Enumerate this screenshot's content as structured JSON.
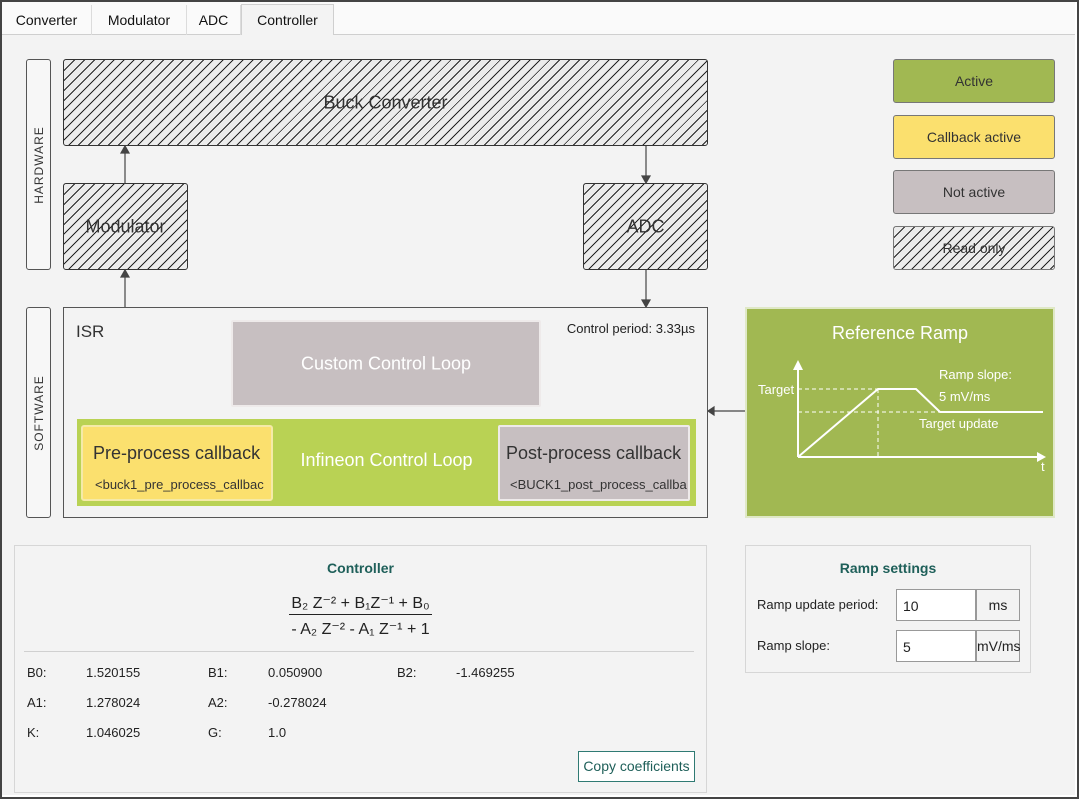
{
  "tabs": [
    {
      "label": "Converter"
    },
    {
      "label": "Modulator"
    },
    {
      "label": "ADC"
    },
    {
      "label": "Controller"
    }
  ],
  "diagram": {
    "hardware_label": "HARDWARE",
    "software_label": "SOFTWARE",
    "buck_converter": "Buck Converter",
    "modulator": "Modulator",
    "adc": "ADC",
    "isr": "ISR",
    "control_period": "Control period: 3.33µs",
    "custom_loop": "Custom Control Loop",
    "infineon_loop": "Infineon Control Loop",
    "pre_process": "Pre-process callback",
    "pre_process_fn": "<buck1_pre_process_callbac",
    "post_process": "Post-process callback",
    "post_process_fn": "<BUCK1_post_process_callba"
  },
  "legend": {
    "active": "Active",
    "callback_active": "Callback active",
    "not_active": "Not active",
    "read_only": "Read only"
  },
  "ramp_diagram": {
    "title": "Reference Ramp",
    "target": "Target",
    "ramp_slope_line1": "Ramp slope:",
    "ramp_slope_line2": "5 mV/ms",
    "target_update": "Target update",
    "t_axis": "t"
  },
  "controller": {
    "title": "Controller",
    "numerator": "B₂ Z⁻² + B₁Z⁻¹ + B₀",
    "denominator": "- A₂ Z⁻² - A₁ Z⁻¹ + 1",
    "coefficients": [
      {
        "label": "B0:",
        "value": "1.520155"
      },
      {
        "label": "B1:",
        "value": "0.050900"
      },
      {
        "label": "B2:",
        "value": "-1.469255"
      },
      {
        "label": "A1:",
        "value": "1.278024"
      },
      {
        "label": "A2:",
        "value": "-0.278024"
      },
      {
        "label": "K:",
        "value": "1.046025"
      },
      {
        "label": "G:",
        "value": "1.0"
      }
    ],
    "copy_button": "Copy coefficients"
  },
  "ramp_settings": {
    "title": "Ramp settings",
    "update_period_label": "Ramp update period:",
    "update_period_value": "10",
    "update_period_unit": "ms",
    "slope_label": "Ramp slope:",
    "slope_value": "5",
    "slope_unit": "mV/ms"
  },
  "colors": {
    "active": "#a1b852",
    "callback_active": "#fbe06e",
    "not_active": "#c7bfc1",
    "infineon_band": "#b9d254",
    "accent_text": "#1e5f59"
  }
}
